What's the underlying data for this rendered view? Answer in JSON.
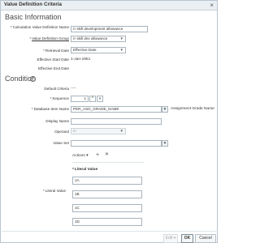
{
  "dialog": {
    "title": "Value Definition Criteria",
    "close_glyph": "×"
  },
  "basic": {
    "heading": "Basic Information",
    "calc_name_label": "Calculation Value Definition Name",
    "calc_name_value": "rr skill development allowance",
    "value_group_label": "Value Definition Group",
    "value_group_value": "rr skill dev allowance",
    "retrieval_date_label": "Retrieval Date",
    "retrieval_date_value": "Effective Date",
    "start_date_label": "Effective Start Date",
    "start_date_value": "1-Jan-1951",
    "end_date_label": "Effective End Date",
    "end_date_value": ""
  },
  "condition": {
    "heading": "Condition",
    "help_glyph": "?",
    "default_criteria_label": "Default Criteria",
    "default_criteria_value": "----",
    "sequence_label": "Sequence",
    "sequence_value": "1",
    "spin_up": "^",
    "spin_down": "v",
    "db_item_label": "Database Item Name",
    "db_item_value": "PER_ASG_GRADE_NAME",
    "db_item_desc": "Assignment Grade Name",
    "display_name_label": "Display Name",
    "display_name_value": "",
    "operand_label": "Operand",
    "operand_value": "In",
    "value_set_label": "Value Set",
    "value_set_value": ""
  },
  "literal": {
    "actions_label": "Actions",
    "actions_arrow": "▾",
    "add_glyph": "+",
    "delete_glyph": "✕",
    "column_header": "Literal Value",
    "row_label": "Literal Value",
    "rows": [
      "1A",
      "1B",
      "1C",
      "1D"
    ]
  },
  "footer": {
    "edit_label": "Edit",
    "ok_label": "OK",
    "cancel_label": "Cancel"
  }
}
